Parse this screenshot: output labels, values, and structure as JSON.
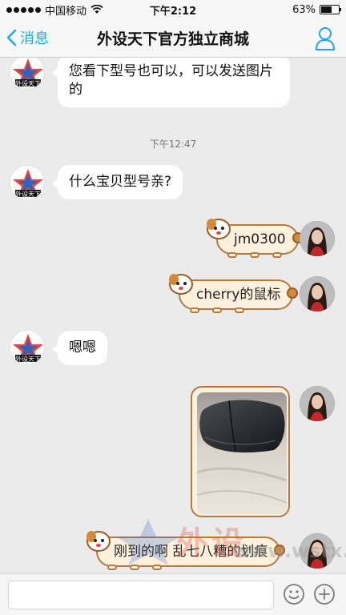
{
  "status_bar": {
    "carrier": "中国移动",
    "time": "下午2:12",
    "battery_text": "63%",
    "battery_level": 0.63
  },
  "nav": {
    "back_label": "消息",
    "title": "外设天下官方独立商城"
  },
  "messages": {
    "m1_text": "您看下型号也可以，可以发送图片的",
    "time_divider": "下午12:47",
    "m2_text": "什么宝贝型号亲?",
    "m3_text": "jm0300",
    "m4_text": "cherry的鼠标",
    "m5_text": "嗯嗯",
    "m7_text": "刚到的啊 乱七八糟的划痕"
  },
  "watermark": {
    "cn_text": "外设",
    "url_text": "www.wstx.com"
  },
  "colors": {
    "accent": "#1aa7f0",
    "chat_bg": "#ebebeb",
    "dog_bubble_bg": "#fdf1dd",
    "dog_bubble_border": "#b47a42"
  },
  "icons": {
    "back": "chevron-left-icon",
    "profile": "person-icon",
    "emoji": "smiley-icon",
    "plus": "plus-icon"
  }
}
